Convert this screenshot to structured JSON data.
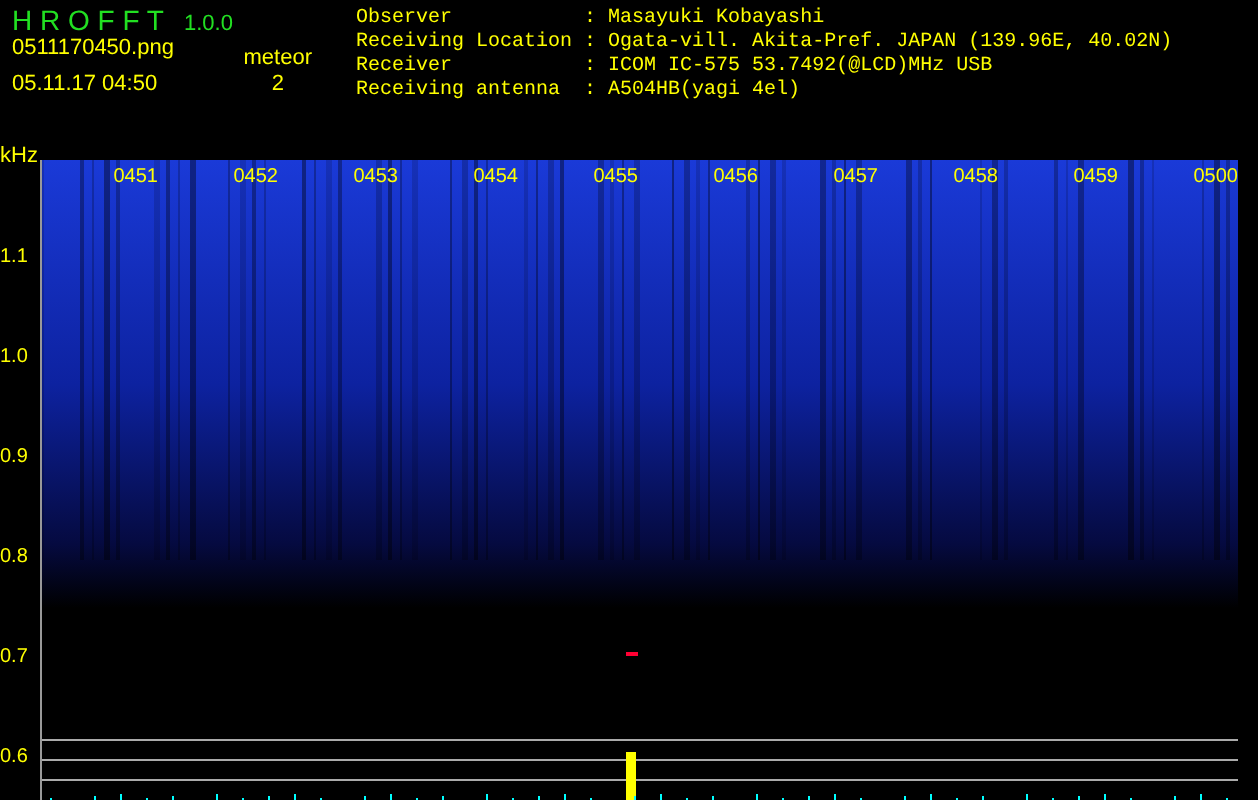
{
  "app": {
    "name": "H R O F F T",
    "version": "1.0.0"
  },
  "file": "0511170450.png",
  "datetime": "05.11.17 04:50",
  "meteor": {
    "label": "meteor",
    "count": "2"
  },
  "station": [
    {
      "label": "Observer",
      "separator": ":",
      "value": "Masayuki Kobayashi"
    },
    {
      "label": "Receiving Location",
      "separator": ":",
      "value": "Ogata-vill. Akita-Pref. JAPAN (139.96E, 40.02N)"
    },
    {
      "label": "Receiver",
      "separator": ":",
      "value": "ICOM IC-575 53.7492(@LCD)MHz USB"
    },
    {
      "label": "Receiving antenna",
      "separator": ":",
      "value": "A504HB(yagi 4el)"
    }
  ],
  "plot": {
    "unit": "kHz",
    "time_labels": [
      "0451",
      "0452",
      "0453",
      "0454",
      "0455",
      "0456",
      "0457",
      "0458",
      "0459",
      "0500"
    ],
    "freq_labels": [
      "1.1",
      "1.0",
      "0.9",
      "0.8",
      "0.7",
      "0.6"
    ]
  }
}
